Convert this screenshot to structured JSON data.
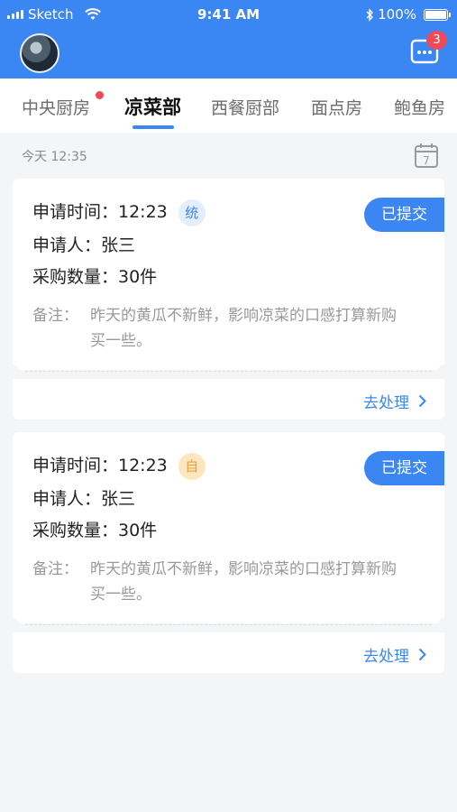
{
  "status_bar": {
    "carrier": "Sketch",
    "time": "9:41 AM",
    "battery": "100%"
  },
  "header": {
    "message_badge": "3"
  },
  "tabs": [
    {
      "label": "中央厨房",
      "has_dot": true
    },
    {
      "label": "凉菜部",
      "active": true
    },
    {
      "label": "西餐厨部"
    },
    {
      "label": "面点房"
    },
    {
      "label": "鲍鱼房"
    }
  ],
  "date_label": "今天 12:35",
  "calendar_day": "7",
  "orders": [
    {
      "time_line": "申请时间：12:23",
      "tag": "统",
      "applicant_line": "申请人：张三",
      "quantity_line": "采购数量：30件",
      "status": "已提交",
      "note_label": "备注：",
      "note_text": "昨天的黄瓜不新鲜，影响凉菜的口感打算新购买一些。",
      "action": "去处理"
    },
    {
      "time_line": "申请时间：12:23",
      "tag": "自",
      "applicant_line": "申请人：张三",
      "quantity_line": "采购数量：30件",
      "status": "已提交",
      "note_label": "备注：",
      "note_text": "昨天的黄瓜不新鲜，影响凉菜的口感打算新购买一些。",
      "action": "去处理"
    }
  ],
  "colors": {
    "primary": "#3a86f3",
    "badge": "#f04a58",
    "tag_blue_bg": "#e5eefc",
    "tag_orange_bg": "#fde6c0"
  }
}
